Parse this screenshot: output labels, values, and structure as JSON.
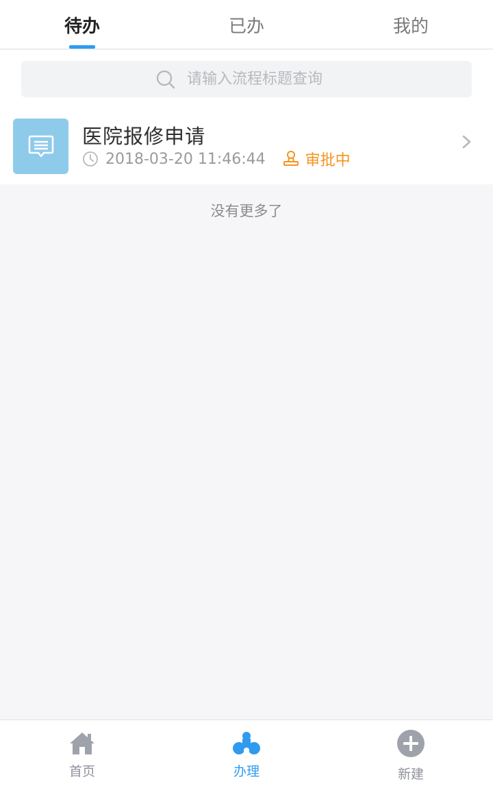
{
  "tabs": [
    {
      "label": "待办",
      "active": true
    },
    {
      "label": "已办",
      "active": false
    },
    {
      "label": "我的",
      "active": false
    }
  ],
  "search": {
    "placeholder": "请输入流程标题查询",
    "icon": "search-icon"
  },
  "list": {
    "items": [
      {
        "icon": "message-icon",
        "title": "医院报修申请",
        "time": "2018-03-20 11:46:44",
        "status": "审批中",
        "status_icon": "stamp-icon"
      }
    ],
    "end_text": "没有更多了"
  },
  "bottom_nav": [
    {
      "label": "首页",
      "icon": "home-icon",
      "active": false
    },
    {
      "label": "办理",
      "icon": "process-icon",
      "active": true
    },
    {
      "label": "新建",
      "icon": "plus-circle-icon",
      "active": false
    }
  ],
  "colors": {
    "accent": "#2f9bf0",
    "status_pending": "#f5931e",
    "thumb_bg": "#8ecbea",
    "background": "#f6f6f8"
  }
}
